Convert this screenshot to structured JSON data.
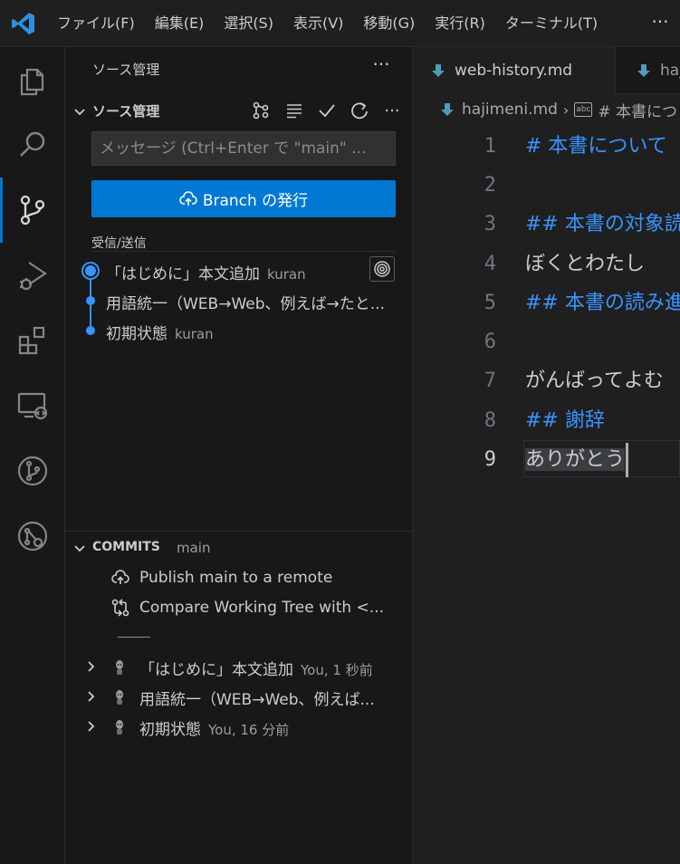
{
  "menu": {
    "items": [
      "ファイル(F)",
      "編集(E)",
      "選択(S)",
      "表示(V)",
      "移動(G)",
      "実行(R)",
      "ターミナル(T)"
    ],
    "more": "···"
  },
  "sidebar": {
    "header": "ソース管理",
    "header_more": "···",
    "scm": {
      "title": "ソース管理",
      "more": "···",
      "input_placeholder": "メッセージ (Ctrl+Enter で \"main\" ...",
      "publish_label": "Branch の発行",
      "incoming_outgoing": "受信/送信",
      "graph": [
        {
          "message": "「はじめに」本文追加",
          "author": "kuran"
        },
        {
          "message": "用語統一（WEB→Web、例えば→たと...",
          "author": ""
        },
        {
          "message": "初期状態",
          "author": "kuran"
        }
      ]
    },
    "commits": {
      "title": "COMMITS",
      "branch": "main",
      "actions": [
        "Publish main to a remote",
        "Compare Working Tree with <..."
      ],
      "separator": "——",
      "rows": [
        {
          "message": "「はじめに」本文追加",
          "meta": "You, 1 秒前"
        },
        {
          "message": "用語統一（WEB→Web、例えば...",
          "meta": ""
        },
        {
          "message": "初期状態",
          "meta": "You, 16 分前"
        }
      ]
    }
  },
  "editor": {
    "tabs": [
      {
        "label": "web-history.md"
      },
      {
        "label": "haj"
      }
    ],
    "breadcrumb": {
      "file": "hajimeni.md",
      "symbol": "# 本書につ",
      "abc": "abc"
    },
    "lines": [
      {
        "n": "1",
        "text": "#  本書について",
        "kind": "heading"
      },
      {
        "n": "2",
        "text": "",
        "kind": "plain"
      },
      {
        "n": "3",
        "text": "##  本書の対象読",
        "kind": "heading"
      },
      {
        "n": "4",
        "text": "ぼくとわたし",
        "kind": "plain"
      },
      {
        "n": "5",
        "text": "##  本書の読み進",
        "kind": "heading"
      },
      {
        "n": "6",
        "text": "",
        "kind": "plain"
      },
      {
        "n": "7",
        "text": "がんばってよむ",
        "kind": "plain"
      },
      {
        "n": "8",
        "text": "##  謝辞",
        "kind": "heading"
      },
      {
        "n": "9",
        "text": "ありがとう",
        "kind": "plain"
      }
    ]
  },
  "colors": {
    "accent": "#0078d4",
    "graph": "#3794ff",
    "heading": "#3794ff",
    "logo": "#2f8fe0"
  }
}
